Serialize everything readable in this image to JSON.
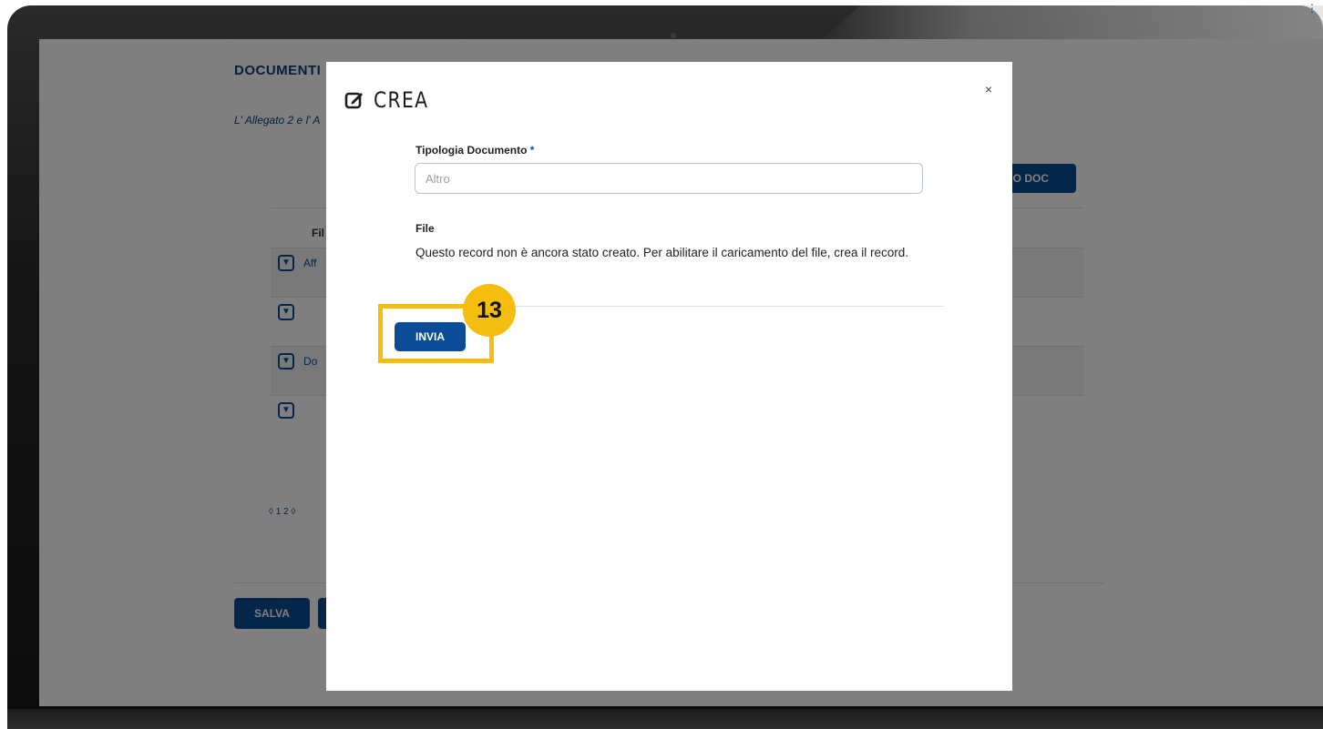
{
  "background_page": {
    "title": "DOCUMENTI",
    "note": "L' Allegato 2 e l' A",
    "new_doc_button": "RO DOC",
    "column_header": "Fil",
    "rows": [
      {
        "text": "Aff"
      },
      {
        "text": ""
      },
      {
        "text": "Do"
      },
      {
        "text": ""
      }
    ],
    "pager": "1 2",
    "save_button": "SALVA"
  },
  "modal": {
    "title": "CREA",
    "close_label": "×",
    "field_label": "Tipologia Documento",
    "required_mark": "*",
    "field_placeholder": "Altro",
    "file_label": "File",
    "file_message": "Questo record non è ancora stato creato. Per abilitare il caricamento del file, crea il record.",
    "submit_button": "INVIA"
  },
  "annotation": {
    "step_number": "13",
    "color": "#f5bd0d"
  },
  "colors": {
    "accent": "#0a4d96",
    "overlay": "rgba(0,0,0,0.5)"
  }
}
